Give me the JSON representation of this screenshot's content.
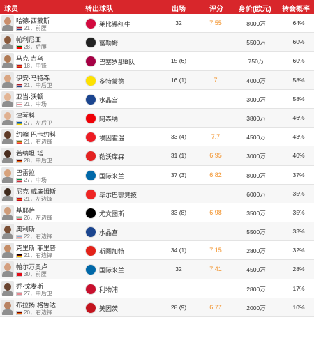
{
  "header": {
    "player": "球员",
    "club": "转出球队",
    "apps": "出场",
    "rating": "评分",
    "value": "身价(欧元)",
    "prob": "转会概率"
  },
  "rows": [
    {
      "name": "哈德·西蒙斯",
      "age": "21",
      "pos": "前腰",
      "flag": [
        "#ae1c28",
        "#ffffff",
        "#21468b"
      ],
      "skin": "#c98e6c",
      "club": "莱比锡红牛",
      "club_icon": "rb-leipzig-icon",
      "club_color": "#d20a3e",
      "apps": "32",
      "rating": "7.55",
      "value": "8000万",
      "prob": "64%"
    },
    {
      "name": "帕利尼亚",
      "age": "28",
      "pos": "后腰",
      "flag": [
        "#006600",
        "#ff0000",
        "#ff0000"
      ],
      "skin": "#8a5a3c",
      "club": "富勒姆",
      "club_icon": "fulham-icon",
      "club_color": "#222222",
      "apps": "",
      "rating": "",
      "value": "5500万",
      "prob": "60%"
    },
    {
      "name": "马克·吉乌",
      "age": "18",
      "pos": "中锋",
      "flag": [
        "#c60b1e",
        "#ffc400",
        "#c60b1e"
      ],
      "skin": "#b07a55",
      "club": "巴塞罗那B队",
      "club_icon": "barcelona-icon",
      "club_color": "#a50044",
      "apps": "15 (6)",
      "rating": "",
      "value": "750万",
      "prob": "60%"
    },
    {
      "name": "伊安·马特森",
      "age": "21",
      "pos": "中后卫",
      "flag": [
        "#ae1c28",
        "#ffffff",
        "#21468b"
      ],
      "skin": "#d9a582",
      "club": "多特蒙德",
      "club_icon": "dortmund-icon",
      "club_color": "#fde100",
      "apps": "16 (1)",
      "rating": "7",
      "value": "4000万",
      "prob": "58%"
    },
    {
      "name": "亚当·沃顿",
      "age": "21",
      "pos": "中场",
      "flag": [
        "#ffffff",
        "#ce1124",
        "#ffffff"
      ],
      "skin": "#e3b595",
      "club": "水晶宫",
      "club_icon": "crystal-palace-icon",
      "club_color": "#1b458f",
      "apps": "",
      "rating": "",
      "value": "3000万",
      "prob": "58%"
    },
    {
      "name": "津琴科",
      "age": "27",
      "pos": "左后卫",
      "flag": [
        "#0057b7",
        "#0057b7",
        "#ffd700"
      ],
      "skin": "#e0b090",
      "club": "阿森纳",
      "club_icon": "arsenal-icon",
      "club_color": "#ef0107",
      "apps": "",
      "rating": "",
      "value": "3800万",
      "prob": "46%"
    },
    {
      "name": "约翰·巴卡约科",
      "age": "21",
      "pos": "右边锋",
      "flag": [
        "#000000",
        "#fdda24",
        "#ef3340"
      ],
      "skin": "#5e3a26",
      "club": "埃因霍温",
      "club_icon": "psv-icon",
      "club_color": "#ed1c24",
      "apps": "33 (4)",
      "rating": "7.7",
      "value": "4500万",
      "prob": "43%"
    },
    {
      "name": "若纳坦·塔",
      "age": "28",
      "pos": "中后卫",
      "flag": [
        "#000000",
        "#dd0000",
        "#ffce00"
      ],
      "skin": "#4a2e1f",
      "club": "勒沃库森",
      "club_icon": "leverkusen-icon",
      "club_color": "#e32221",
      "apps": "31 (1)",
      "rating": "6.95",
      "value": "3000万",
      "prob": "40%"
    },
    {
      "name": "巴雷拉",
      "age": "27",
      "pos": "中场",
      "flag": [
        "#009246",
        "#ffffff",
        "#ce2b37"
      ],
      "skin": "#d7a27c",
      "club": "国际米兰",
      "club_icon": "inter-icon",
      "club_color": "#0068a8",
      "apps": "37 (3)",
      "rating": "6.82",
      "value": "8000万",
      "prob": "37%"
    },
    {
      "name": "尼克·威廉姆斯",
      "age": "21",
      "pos": "左边锋",
      "flag": [
        "#c60b1e",
        "#ffc400",
        "#c60b1e"
      ],
      "skin": "#3f2a1d",
      "club": "毕尔巴鄂竞技",
      "club_icon": "athletic-bilbao-icon",
      "club_color": "#ee2523",
      "apps": "",
      "rating": "",
      "value": "6000万",
      "prob": "35%"
    },
    {
      "name": "基耶萨",
      "age": "26",
      "pos": "左边锋",
      "flag": [
        "#009246",
        "#ffffff",
        "#ce2b37"
      ],
      "skin": "#cf9c79",
      "club": "尤文图斯",
      "club_icon": "juventus-icon",
      "club_color": "#000000",
      "apps": "33 (8)",
      "rating": "6.98",
      "value": "3500万",
      "prob": "35%"
    },
    {
      "name": "奥利斯",
      "age": "22",
      "pos": "右边锋",
      "flag": [
        "#0055a4",
        "#ffffff",
        "#ef4135"
      ],
      "skin": "#7a4f35",
      "club": "水晶宫",
      "club_icon": "crystal-palace-icon",
      "club_color": "#1b458f",
      "apps": "",
      "rating": "",
      "value": "5500万",
      "prob": "33%"
    },
    {
      "name": "克里斯·菲里普",
      "age": "21",
      "pos": "右边锋",
      "flag": [
        "#000000",
        "#dd0000",
        "#ffce00"
      ],
      "skin": "#c48c66",
      "club": "斯图加特",
      "club_icon": "stuttgart-icon",
      "club_color": "#e32219",
      "apps": "34 (1)",
      "rating": "7.15",
      "value": "2800万",
      "prob": "32%"
    },
    {
      "name": "帕尔万奥卢",
      "age": "30",
      "pos": "前腰",
      "flag": [
        "#e30a17",
        "#e30a17",
        "#e30a17"
      ],
      "skin": "#d49f7f",
      "club": "国际米兰",
      "club_icon": "inter-icon",
      "club_color": "#0068a8",
      "apps": "32",
      "rating": "7.41",
      "value": "4500万",
      "prob": "28%"
    },
    {
      "name": "乔·戈麦斯",
      "age": "27",
      "pos": "中后卫",
      "flag": [
        "#ffffff",
        "#ce1124",
        "#ffffff"
      ],
      "skin": "#6a4430",
      "club": "利物浦",
      "club_icon": "liverpool-icon",
      "club_color": "#c8102e",
      "apps": "",
      "rating": "",
      "value": "2800万",
      "prob": "17%"
    },
    {
      "name": "布拉扬·格鲁达",
      "age": "20",
      "pos": "右边锋",
      "flag": [
        "#000000",
        "#dd0000",
        "#ffce00"
      ],
      "skin": "#b88262",
      "club": "美因茨",
      "club_icon": "mainz-icon",
      "club_color": "#c3141e",
      "apps": "28 (9)",
      "rating": "6.77",
      "value": "2000万",
      "prob": "10%"
    }
  ]
}
